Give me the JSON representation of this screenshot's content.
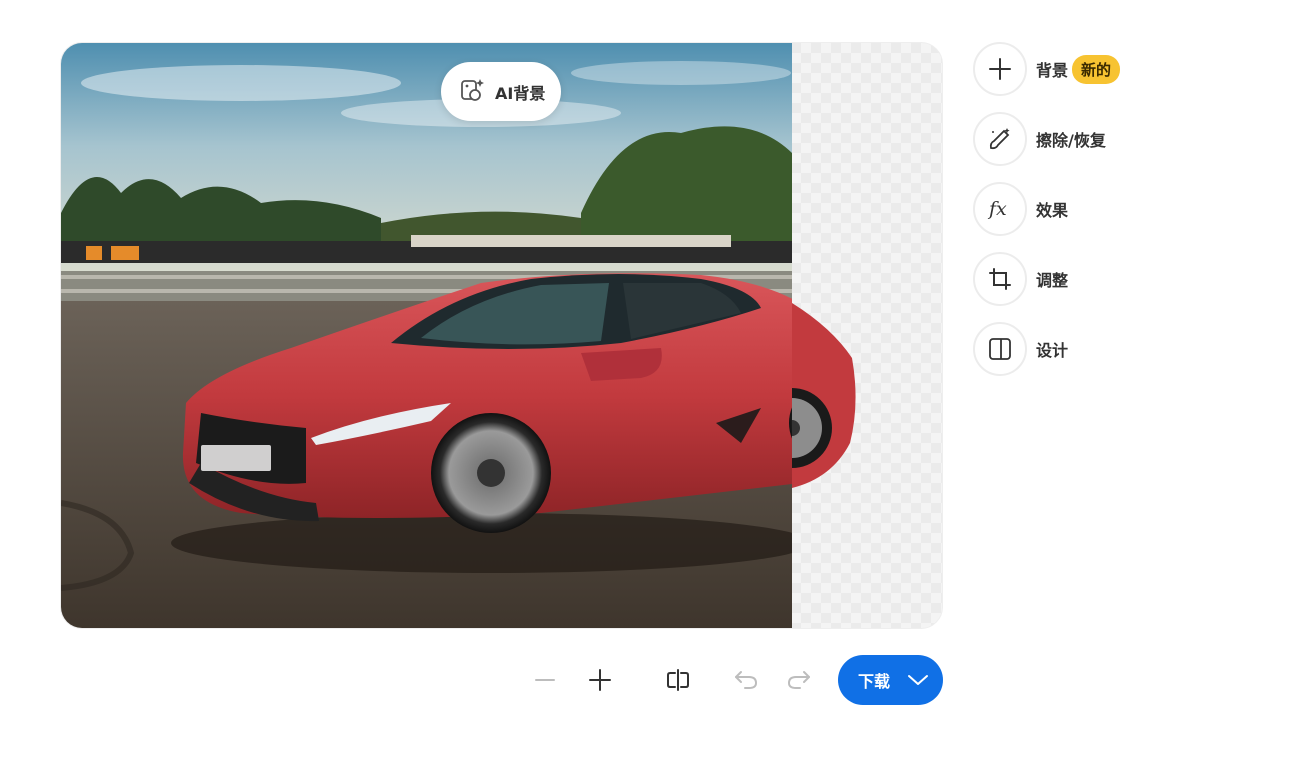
{
  "canvas": {
    "ai_background_label": "AI背景",
    "photo_subject": "red sports car on race track"
  },
  "tools": [
    {
      "label": "背景",
      "icon": "plus-icon",
      "badge": "新的"
    },
    {
      "label": "擦除/恢复",
      "icon": "magic-brush-icon"
    },
    {
      "label": "效果",
      "icon": "fx-icon"
    },
    {
      "label": "调整",
      "icon": "crop-icon"
    },
    {
      "label": "设计",
      "icon": "layout-panel-icon"
    }
  ],
  "toolbar": {
    "zoom_out_icon": "minus-icon",
    "zoom_in_icon": "plus-icon",
    "compare_icon": "compare-icon",
    "undo_icon": "undo-icon",
    "redo_icon": "redo-icon",
    "download_label": "下载"
  },
  "colors": {
    "accent": "#1070e6",
    "badge": "#f7c331",
    "car": "#c8363a"
  }
}
